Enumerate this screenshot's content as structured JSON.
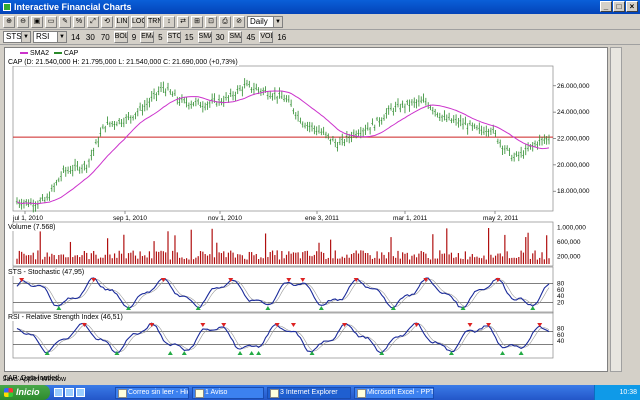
{
  "window": {
    "title": "Interactive Financial Charts",
    "buttons": [
      "_",
      "□",
      "×"
    ]
  },
  "toolbar1": {
    "tool_labels": [
      "⊕",
      "⊖",
      "▣",
      "▭",
      "✎",
      "%",
      "⤢",
      "⟲",
      "LIN",
      "LOG",
      "TRN",
      "↕",
      "⇄",
      "⊞",
      "⊡",
      "⎙",
      "⊘"
    ],
    "period_value": "Daily",
    "period_options_visible": [
      "Daily"
    ]
  },
  "toolbar2": {
    "symbol_value": "STS",
    "indicator_value": "RSI",
    "params": [
      "14",
      "30",
      "70"
    ],
    "btn_a": "BOL",
    "param_a": "9",
    "btn_b": "EMA",
    "param_b": "5",
    "btn_c": "STO",
    "param_c": "15",
    "btn_d": "SMA",
    "param_d": "30",
    "btn_e": "SMA",
    "param_e": "45",
    "btn_f": "VOL",
    "param_f": "16"
  },
  "price_pane": {
    "header": "CAP (D: 21.540,000  H: 21.795,000  L: 21.540,000  C: 21.690,000 (+0,73%)",
    "legend": [
      {
        "name": "SMA2",
        "color": "#cc33cc"
      },
      {
        "name": "CAP",
        "color": "#2a8a2a"
      }
    ],
    "y_ticks": [
      "26.000,000",
      "24.000,000",
      "22.000,000",
      "20.000,000",
      "18.000,000"
    ],
    "x_ticks": [
      "jul 1, 2010",
      "sep 1, 2010",
      "nov 1, 2010",
      "ene 3, 2011",
      "mar 1, 2011",
      "may 2, 2011"
    ],
    "reference_line": 22100
  },
  "volume_pane": {
    "header": "Volume (7.568)",
    "y_ticks": [
      "1.000,000",
      "600,000",
      "200,000"
    ]
  },
  "sts_pane": {
    "header": "STS - Stochastic (47,95)",
    "y_ticks": [
      "80",
      "60",
      "40",
      "20"
    ]
  },
  "rsi_pane": {
    "header": "RSI - Relative Strength Index (46,51)",
    "y_ticks": [
      "80",
      "60",
      "40"
    ]
  },
  "status": {
    "text": "CAP: Data loaded",
    "applet": "Java Applet Window"
  },
  "taskbar": {
    "start_label": "Inicio",
    "tasks": [
      {
        "label": "Correo sin leer - Hio ..."
      },
      {
        "label": "1 Aviso"
      },
      {
        "label": "3 Internet Explorer"
      },
      {
        "label": "Microsoft Excel - PPT..."
      }
    ],
    "clock": "10:38"
  },
  "colors": {
    "price_bars": "#2a8a2a",
    "sma": "#cc33cc",
    "ref_line": "#cc2222",
    "volume": "#b01010",
    "osc_line": "#1a2a9a",
    "sell_marker": "#dd2222",
    "buy_marker": "#22aa44"
  }
}
